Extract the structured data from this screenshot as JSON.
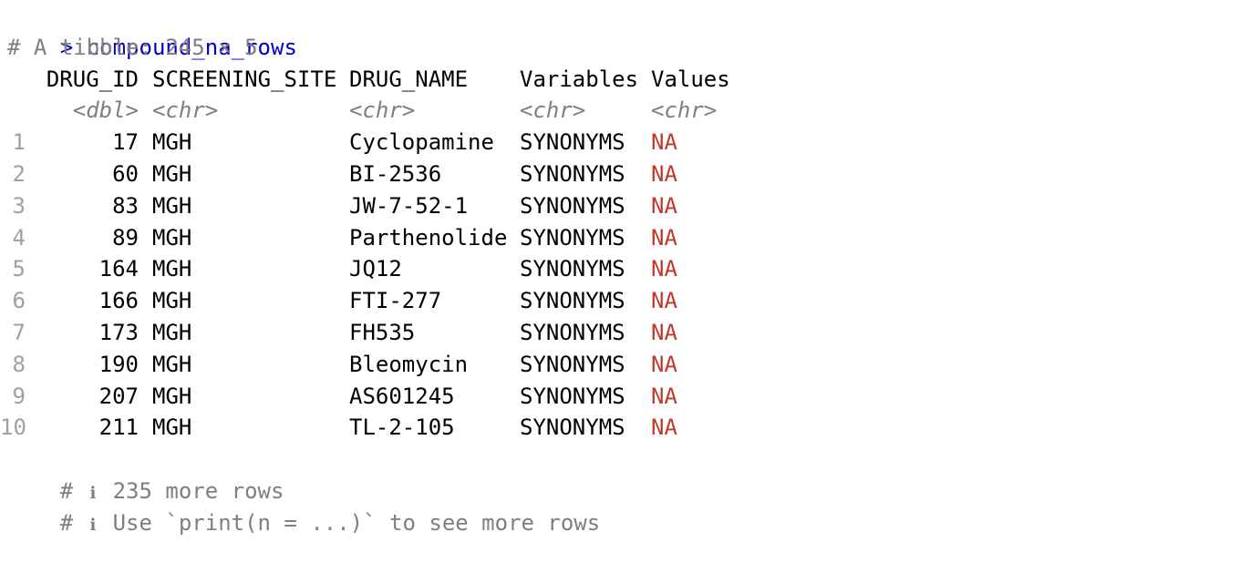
{
  "console": {
    "prompt_symbol": ">",
    "command": "compound_na_rows",
    "tibble_header": "# A tibble: 245 × 5",
    "columns": [
      {
        "name": "DRUG_ID",
        "type": "<dbl>"
      },
      {
        "name": "SCREENING_SITE",
        "type": "<chr>"
      },
      {
        "name": "DRUG_NAME",
        "type": "<chr>"
      },
      {
        "name": "Variables",
        "type": "<chr>"
      },
      {
        "name": "Values",
        "type": "<chr>"
      }
    ],
    "rows": [
      {
        "n": "1",
        "drug_id": "17",
        "site": "MGH",
        "drug_name": "Cyclopamine",
        "variables": "SYNONYMS",
        "values": "NA"
      },
      {
        "n": "2",
        "drug_id": "60",
        "site": "MGH",
        "drug_name": "BI-2536",
        "variables": "SYNONYMS",
        "values": "NA"
      },
      {
        "n": "3",
        "drug_id": "83",
        "site": "MGH",
        "drug_name": "JW-7-52-1",
        "variables": "SYNONYMS",
        "values": "NA"
      },
      {
        "n": "4",
        "drug_id": "89",
        "site": "MGH",
        "drug_name": "Parthenolide",
        "variables": "SYNONYMS",
        "values": "NA"
      },
      {
        "n": "5",
        "drug_id": "164",
        "site": "MGH",
        "drug_name": "JQ12",
        "variables": "SYNONYMS",
        "values": "NA"
      },
      {
        "n": "6",
        "drug_id": "166",
        "site": "MGH",
        "drug_name": "FTI-277",
        "variables": "SYNONYMS",
        "values": "NA"
      },
      {
        "n": "7",
        "drug_id": "173",
        "site": "MGH",
        "drug_name": "FH535",
        "variables": "SYNONYMS",
        "values": "NA"
      },
      {
        "n": "8",
        "drug_id": "190",
        "site": "MGH",
        "drug_name": "Bleomycin",
        "variables": "SYNONYMS",
        "values": "NA"
      },
      {
        "n": "9",
        "drug_id": "207",
        "site": "MGH",
        "drug_name": "AS601245",
        "variables": "SYNONYMS",
        "values": "NA"
      },
      {
        "n": "10",
        "drug_id": "211",
        "site": "MGH",
        "drug_name": "TL-2-105",
        "variables": "SYNONYMS",
        "values": "NA"
      }
    ],
    "footer": {
      "hash": "#",
      "info_symbol": "ℹ",
      "more_rows": "235 more rows",
      "hint": "Use `print(n = ...)` to see more rows"
    },
    "colors": {
      "prompt": "#0000cc",
      "comment": "#7f7f7f",
      "na": "#c0392b"
    }
  }
}
